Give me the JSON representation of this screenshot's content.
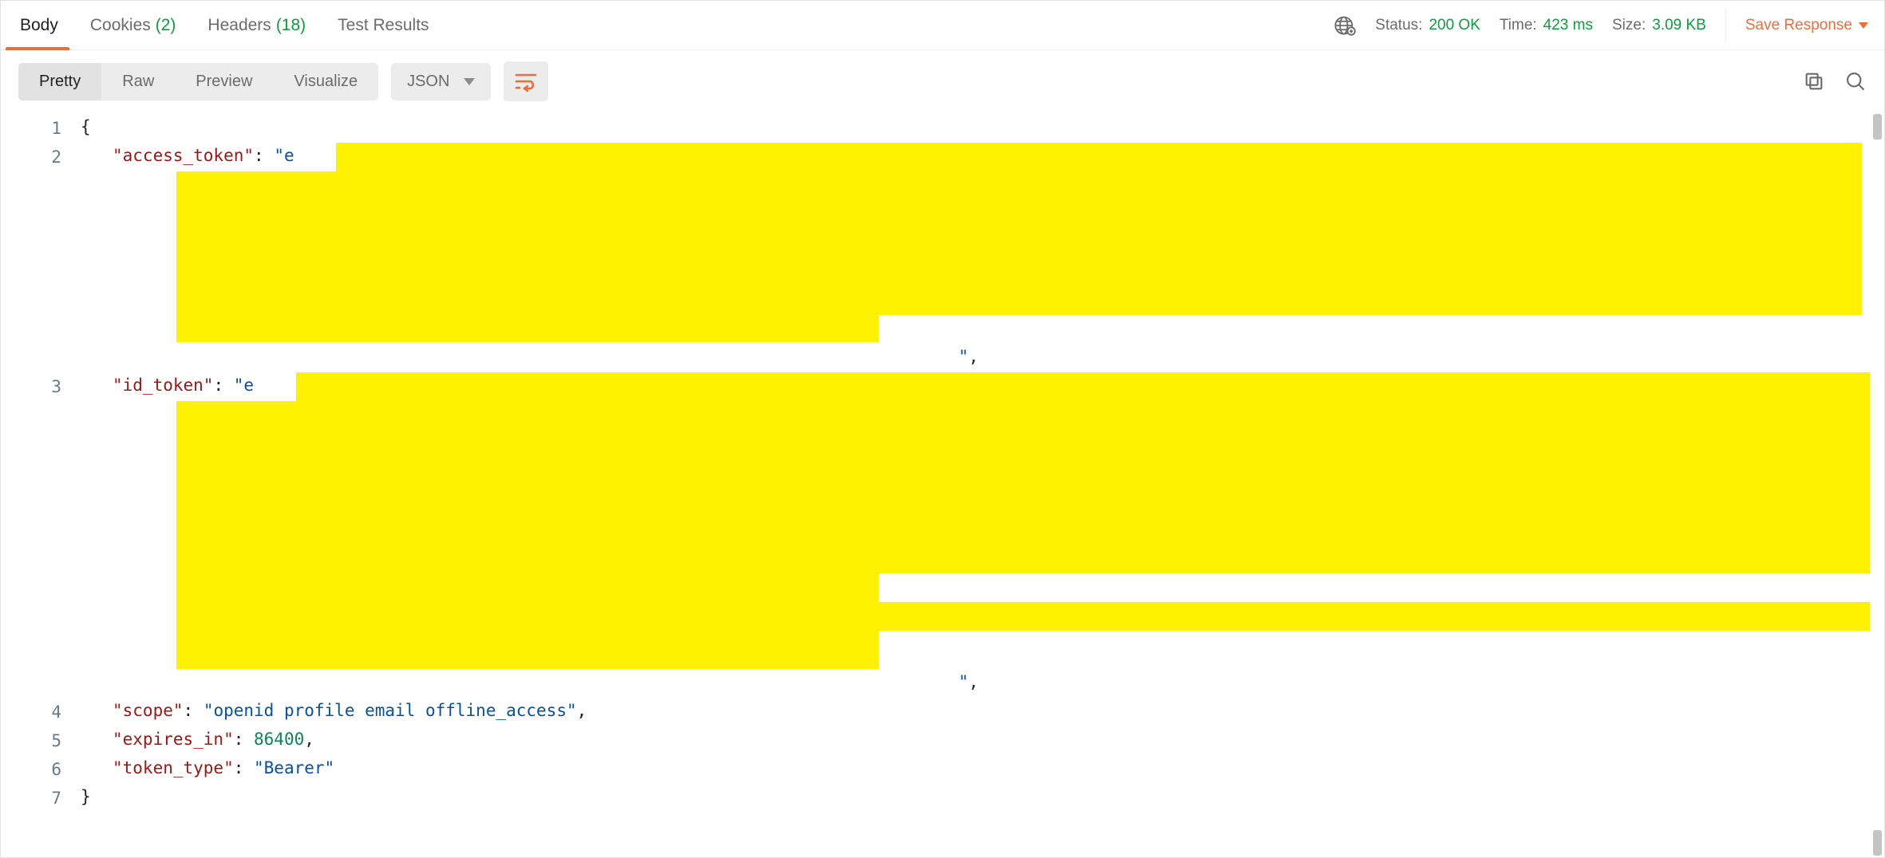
{
  "tabs": {
    "body": "Body",
    "cookies": "Cookies",
    "cookies_count": "(2)",
    "headers": "Headers",
    "headers_count": "(18)",
    "test_results": "Test Results"
  },
  "status": {
    "status_label": "Status:",
    "status_value": "200 OK",
    "time_label": "Time:",
    "time_value": "423 ms",
    "size_label": "Size:",
    "size_value": "3.09 KB"
  },
  "save_response": "Save Response",
  "view_modes": {
    "pretty": "Pretty",
    "raw": "Raw",
    "preview": "Preview",
    "visualize": "Visualize"
  },
  "language": "JSON",
  "gutter": [
    "1",
    "2",
    "3",
    "4",
    "5",
    "6",
    "7"
  ],
  "json_body": {
    "open_brace": "{",
    "close_brace": "}",
    "keys": {
      "access_token": "\"access_token\"",
      "id_token": "\"id_token\"",
      "scope": "\"scope\"",
      "expires_in": "\"expires_in\"",
      "token_type": "\"token_type\""
    },
    "values": {
      "access_token_prefix": "\"e",
      "access_token_suffix": "\"",
      "id_token_prefix": "\"e",
      "id_token_suffix": "\"",
      "scope": "\"openid profile email offline_access\"",
      "expires_in": "86400",
      "token_type": "\"Bearer\""
    },
    "colon": ": ",
    "comma": ","
  }
}
